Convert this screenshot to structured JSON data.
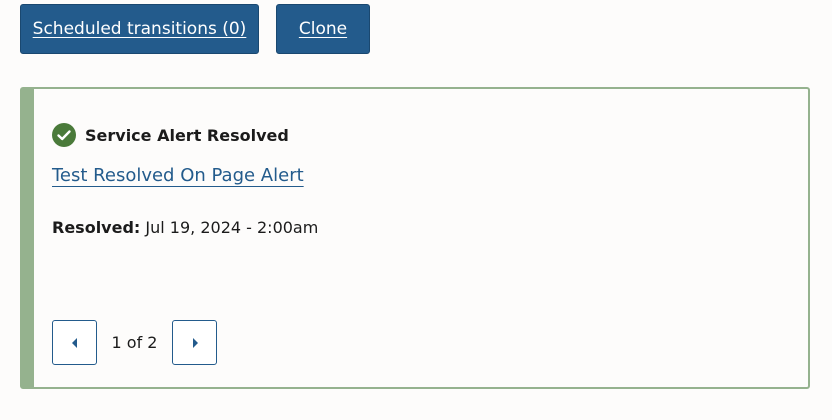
{
  "toolbar": {
    "scheduled_label": "Scheduled transitions (0)",
    "clone_label": "Clone"
  },
  "alert": {
    "status_icon": "check-circle-icon",
    "status_text": "Service Alert Resolved",
    "link_text": "Test Resolved On Page Alert",
    "resolved_label": "Resolved:",
    "resolved_value": "Jul 19, 2024 - 2:00am",
    "accent_color": "#95b28e",
    "icon_color": "#4a7a3a"
  },
  "pager": {
    "prev_icon": "caret-left-icon",
    "next_icon": "caret-right-icon",
    "count_text": "1 of 2"
  }
}
